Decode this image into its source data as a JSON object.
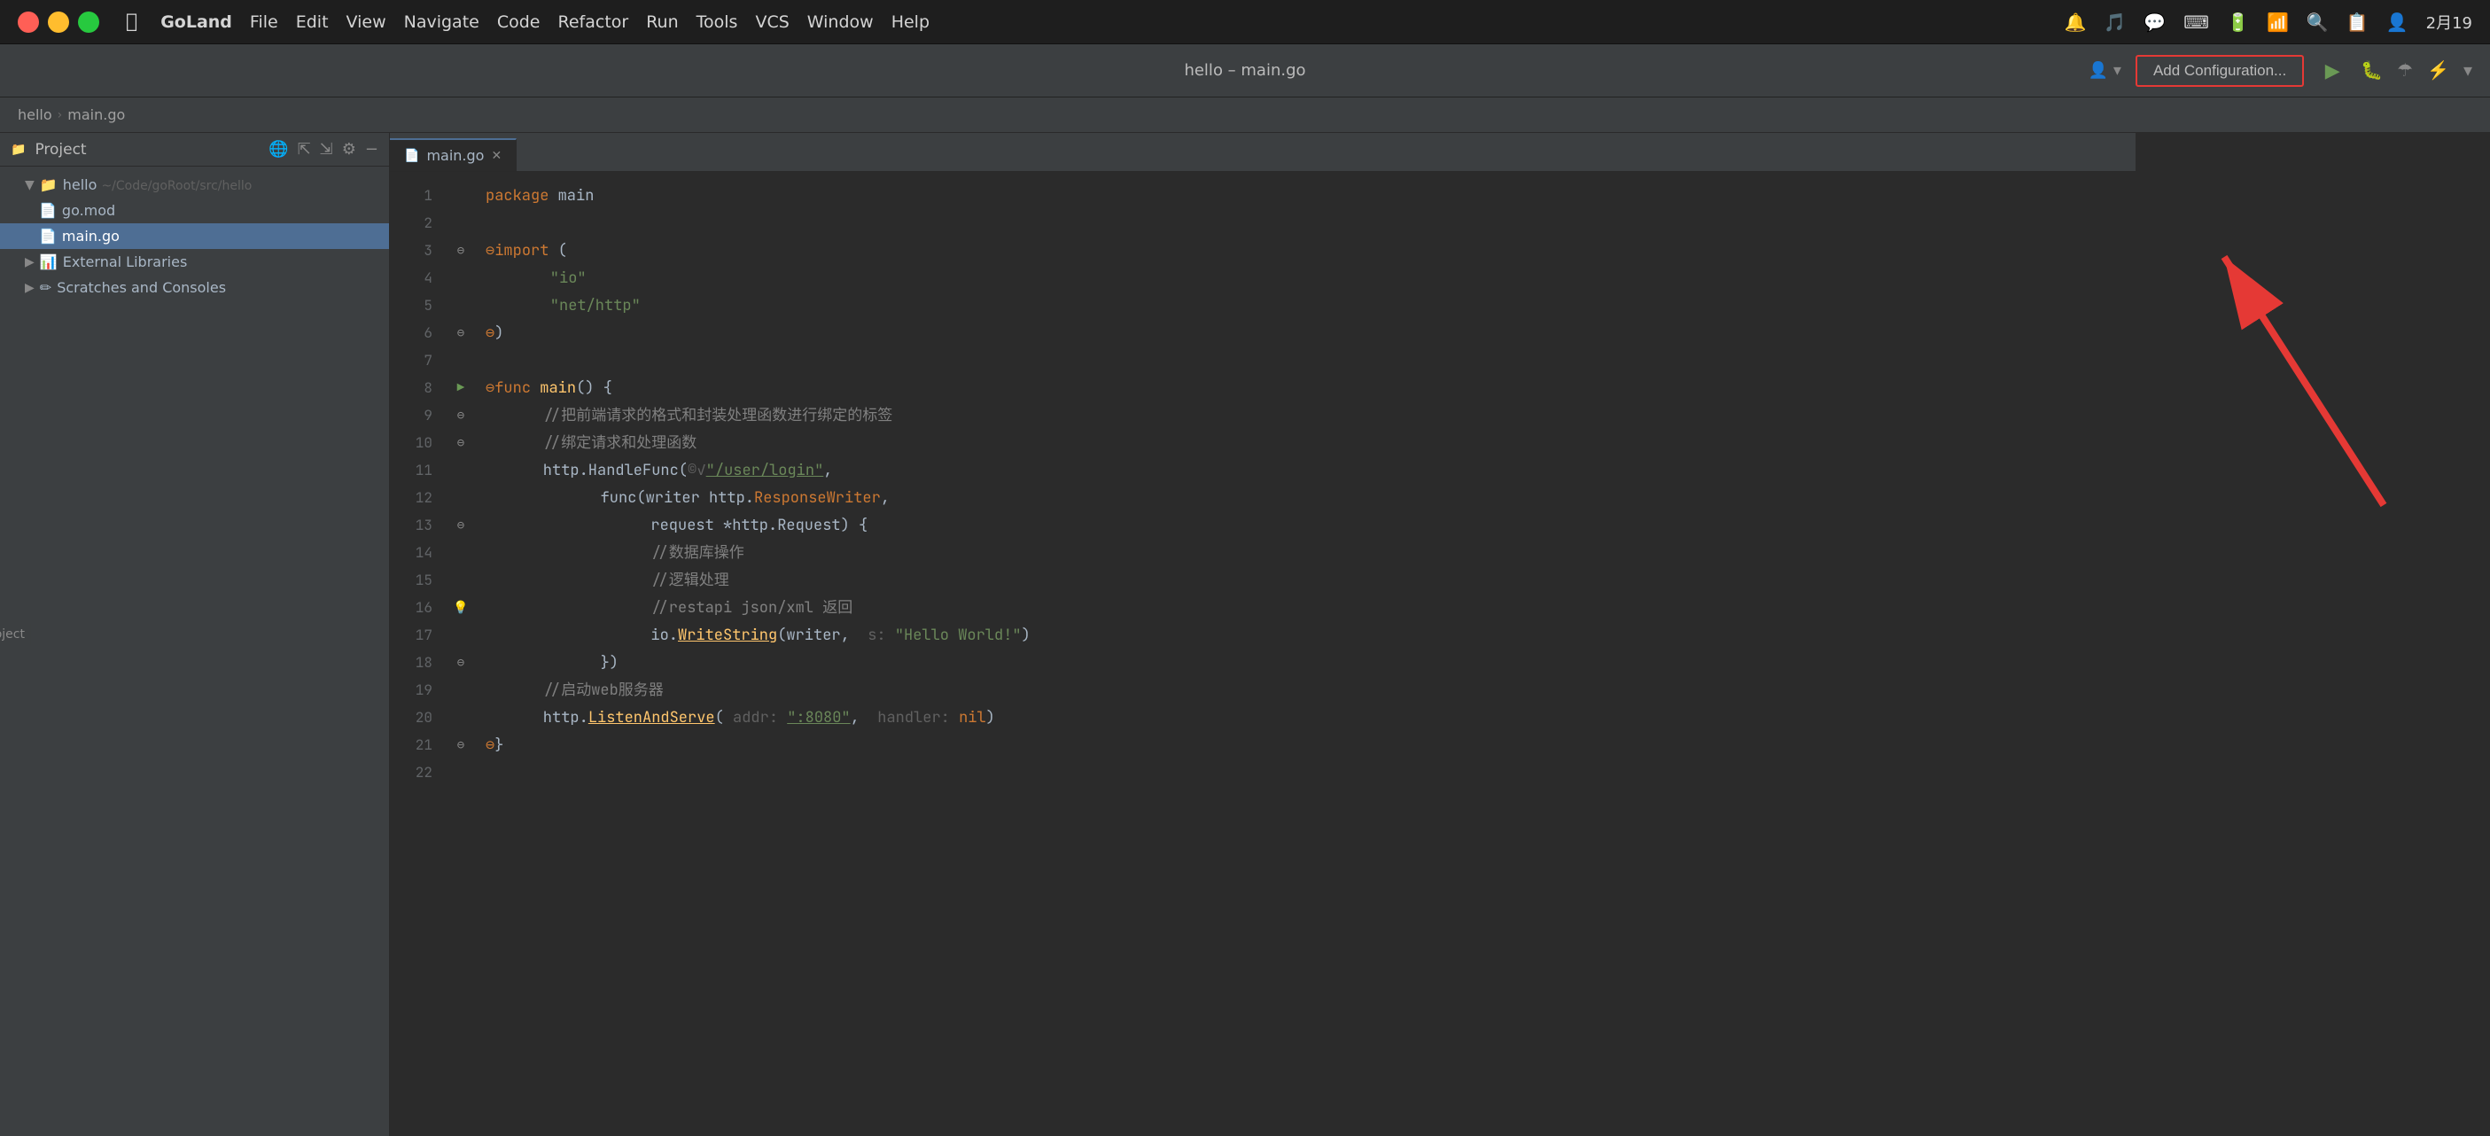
{
  "menubar": {
    "apple": "⌘",
    "items": [
      "GoLand",
      "File",
      "Edit",
      "View",
      "Navigate",
      "Code",
      "Refactor",
      "Run",
      "Tools",
      "VCS",
      "Window",
      "Help"
    ],
    "time": "2月19",
    "icons": [
      "🔔",
      "🔔",
      "🎵",
      "💬",
      "A",
      "🔋",
      "⌨",
      "📶",
      "🔍",
      "📋",
      "👤"
    ]
  },
  "titlebar": {
    "title": "hello – main.go",
    "add_config_label": "Add Configuration..."
  },
  "breadcrumb": {
    "project": "hello",
    "file": "main.go"
  },
  "sidebar": {
    "tab_label": "Project",
    "title": "Project",
    "items": [
      {
        "label": "hello ~/Code/goRoot/src/hello",
        "type": "folder",
        "indent": 1,
        "expanded": true
      },
      {
        "label": "go.mod",
        "type": "gomod",
        "indent": 2
      },
      {
        "label": "main.go",
        "type": "gofile",
        "indent": 2,
        "selected": true
      },
      {
        "label": "External Libraries",
        "type": "lib",
        "indent": 1,
        "expanded": false
      },
      {
        "label": "Scratches and Consoles",
        "type": "scratch",
        "indent": 1,
        "expanded": false
      }
    ]
  },
  "editor": {
    "tab_filename": "main.go",
    "lines": [
      {
        "num": 1,
        "gutter": "",
        "content": [
          {
            "text": "package ",
            "cls": "kw"
          },
          {
            "text": "main",
            "cls": ""
          }
        ]
      },
      {
        "num": 2,
        "gutter": "",
        "content": []
      },
      {
        "num": 3,
        "gutter": "bp",
        "content": [
          {
            "text": "import",
            "cls": "kw"
          },
          {
            "text": " (",
            "cls": ""
          }
        ]
      },
      {
        "num": 4,
        "gutter": "",
        "content": [
          {
            "text": "    \"io\"",
            "cls": "import-str"
          }
        ]
      },
      {
        "num": 5,
        "gutter": "",
        "content": [
          {
            "text": "    \"net/http\"",
            "cls": "import-str"
          }
        ]
      },
      {
        "num": 6,
        "gutter": "bp",
        "content": [
          {
            "text": ")",
            "cls": ""
          }
        ]
      },
      {
        "num": 7,
        "gutter": "",
        "content": []
      },
      {
        "num": 8,
        "gutter": "run",
        "content": [
          {
            "text": "func ",
            "cls": "kw"
          },
          {
            "text": "main",
            "cls": "fn"
          },
          {
            "text": "() {",
            "cls": ""
          }
        ]
      },
      {
        "num": 9,
        "gutter": "bp",
        "content": [
          {
            "text": "    //把前端请求的格式和封装处理函数进行绑定的标签",
            "cls": "comment"
          }
        ]
      },
      {
        "num": 10,
        "gutter": "bp",
        "content": [
          {
            "text": "    //绑定请求和处理函数",
            "cls": "comment"
          }
        ]
      },
      {
        "num": 11,
        "gutter": "",
        "content": [
          {
            "text": "    http.HandleFunc(",
            "cls": ""
          },
          {
            "text": "©✓",
            "cls": ""
          },
          {
            "text": "\"/user/login\"",
            "cls": "str underline"
          },
          {
            "text": ",",
            "cls": ""
          }
        ]
      },
      {
        "num": 12,
        "gutter": "",
        "content": [
          {
            "text": "        func(writer http.",
            "cls": ""
          },
          {
            "text": "ResponseWriter",
            "cls": "kw"
          },
          {
            "text": ",",
            "cls": ""
          }
        ]
      },
      {
        "num": 13,
        "gutter": "bp",
        "content": [
          {
            "text": "            request *http.Request) {",
            "cls": ""
          }
        ]
      },
      {
        "num": 14,
        "gutter": "",
        "content": [
          {
            "text": "            //数据库操作",
            "cls": "comment"
          }
        ]
      },
      {
        "num": 15,
        "gutter": "",
        "content": [
          {
            "text": "            //逻辑处理",
            "cls": "comment"
          }
        ]
      },
      {
        "num": 16,
        "gutter": "bulb",
        "content": [
          {
            "text": "            //restapi json/xml 返回",
            "cls": "comment"
          }
        ]
      },
      {
        "num": 17,
        "gutter": "",
        "content": [
          {
            "text": "            io.",
            "cls": ""
          },
          {
            "text": "WriteString",
            "cls": "fn underline"
          },
          {
            "text": "(writer,  s: \"Hello World!\")",
            "cls": ""
          }
        ]
      },
      {
        "num": 18,
        "gutter": "bp",
        "content": [
          {
            "text": "        })",
            "cls": ""
          }
        ]
      },
      {
        "num": 19,
        "gutter": "",
        "content": [
          {
            "text": "    //启动web服务器",
            "cls": "comment"
          }
        ]
      },
      {
        "num": 20,
        "gutter": "",
        "content": [
          {
            "text": "    http.",
            "cls": ""
          },
          {
            "text": "ListenAndServe",
            "cls": "fn underline"
          },
          {
            "text": "( addr: ",
            "cls": "comment"
          },
          {
            "text": "\":8080\"",
            "cls": "str underline"
          },
          {
            "text": ",  handler: ",
            "cls": "comment"
          },
          {
            "text": "nil",
            "cls": "kw"
          },
          {
            "text": ")",
            "cls": ""
          }
        ]
      },
      {
        "num": 21,
        "gutter": "bp",
        "content": [
          {
            "text": "}",
            "cls": ""
          }
        ]
      },
      {
        "num": 22,
        "gutter": "",
        "content": []
      }
    ]
  },
  "arrow": {
    "color": "#e53935"
  }
}
